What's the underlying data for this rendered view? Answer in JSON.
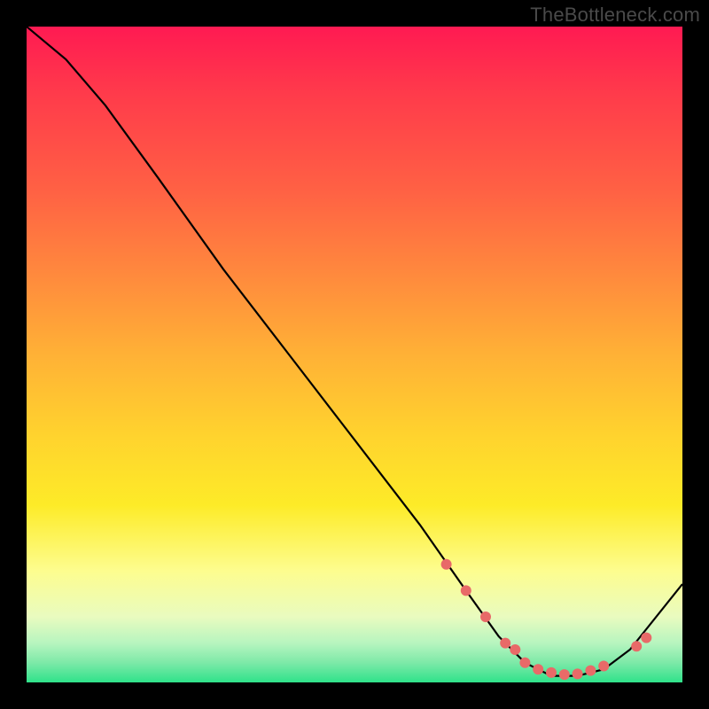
{
  "watermark": "TheBottleneck.com",
  "chart_data": {
    "type": "line",
    "title": "",
    "xlabel": "",
    "ylabel": "",
    "xlim": [
      0,
      100
    ],
    "ylim": [
      0,
      100
    ],
    "series": [
      {
        "name": "curve",
        "x": [
          0,
          6,
          12,
          20,
          30,
          40,
          50,
          60,
          67,
          72,
          76,
          80,
          84,
          88,
          92,
          100
        ],
        "y": [
          100,
          95,
          88,
          77,
          63,
          50,
          37,
          24,
          14,
          7,
          3,
          1,
          1,
          2,
          5,
          15
        ]
      }
    ],
    "markers": {
      "name": "dots",
      "color": "#e86a68",
      "x": [
        64,
        67,
        70,
        73,
        74.5,
        76,
        78,
        80,
        82,
        84,
        86,
        88,
        93,
        94.5
      ],
      "y": [
        18,
        14,
        10,
        6,
        5,
        3,
        2,
        1.5,
        1.2,
        1.3,
        1.8,
        2.5,
        5.5,
        6.8
      ]
    }
  }
}
